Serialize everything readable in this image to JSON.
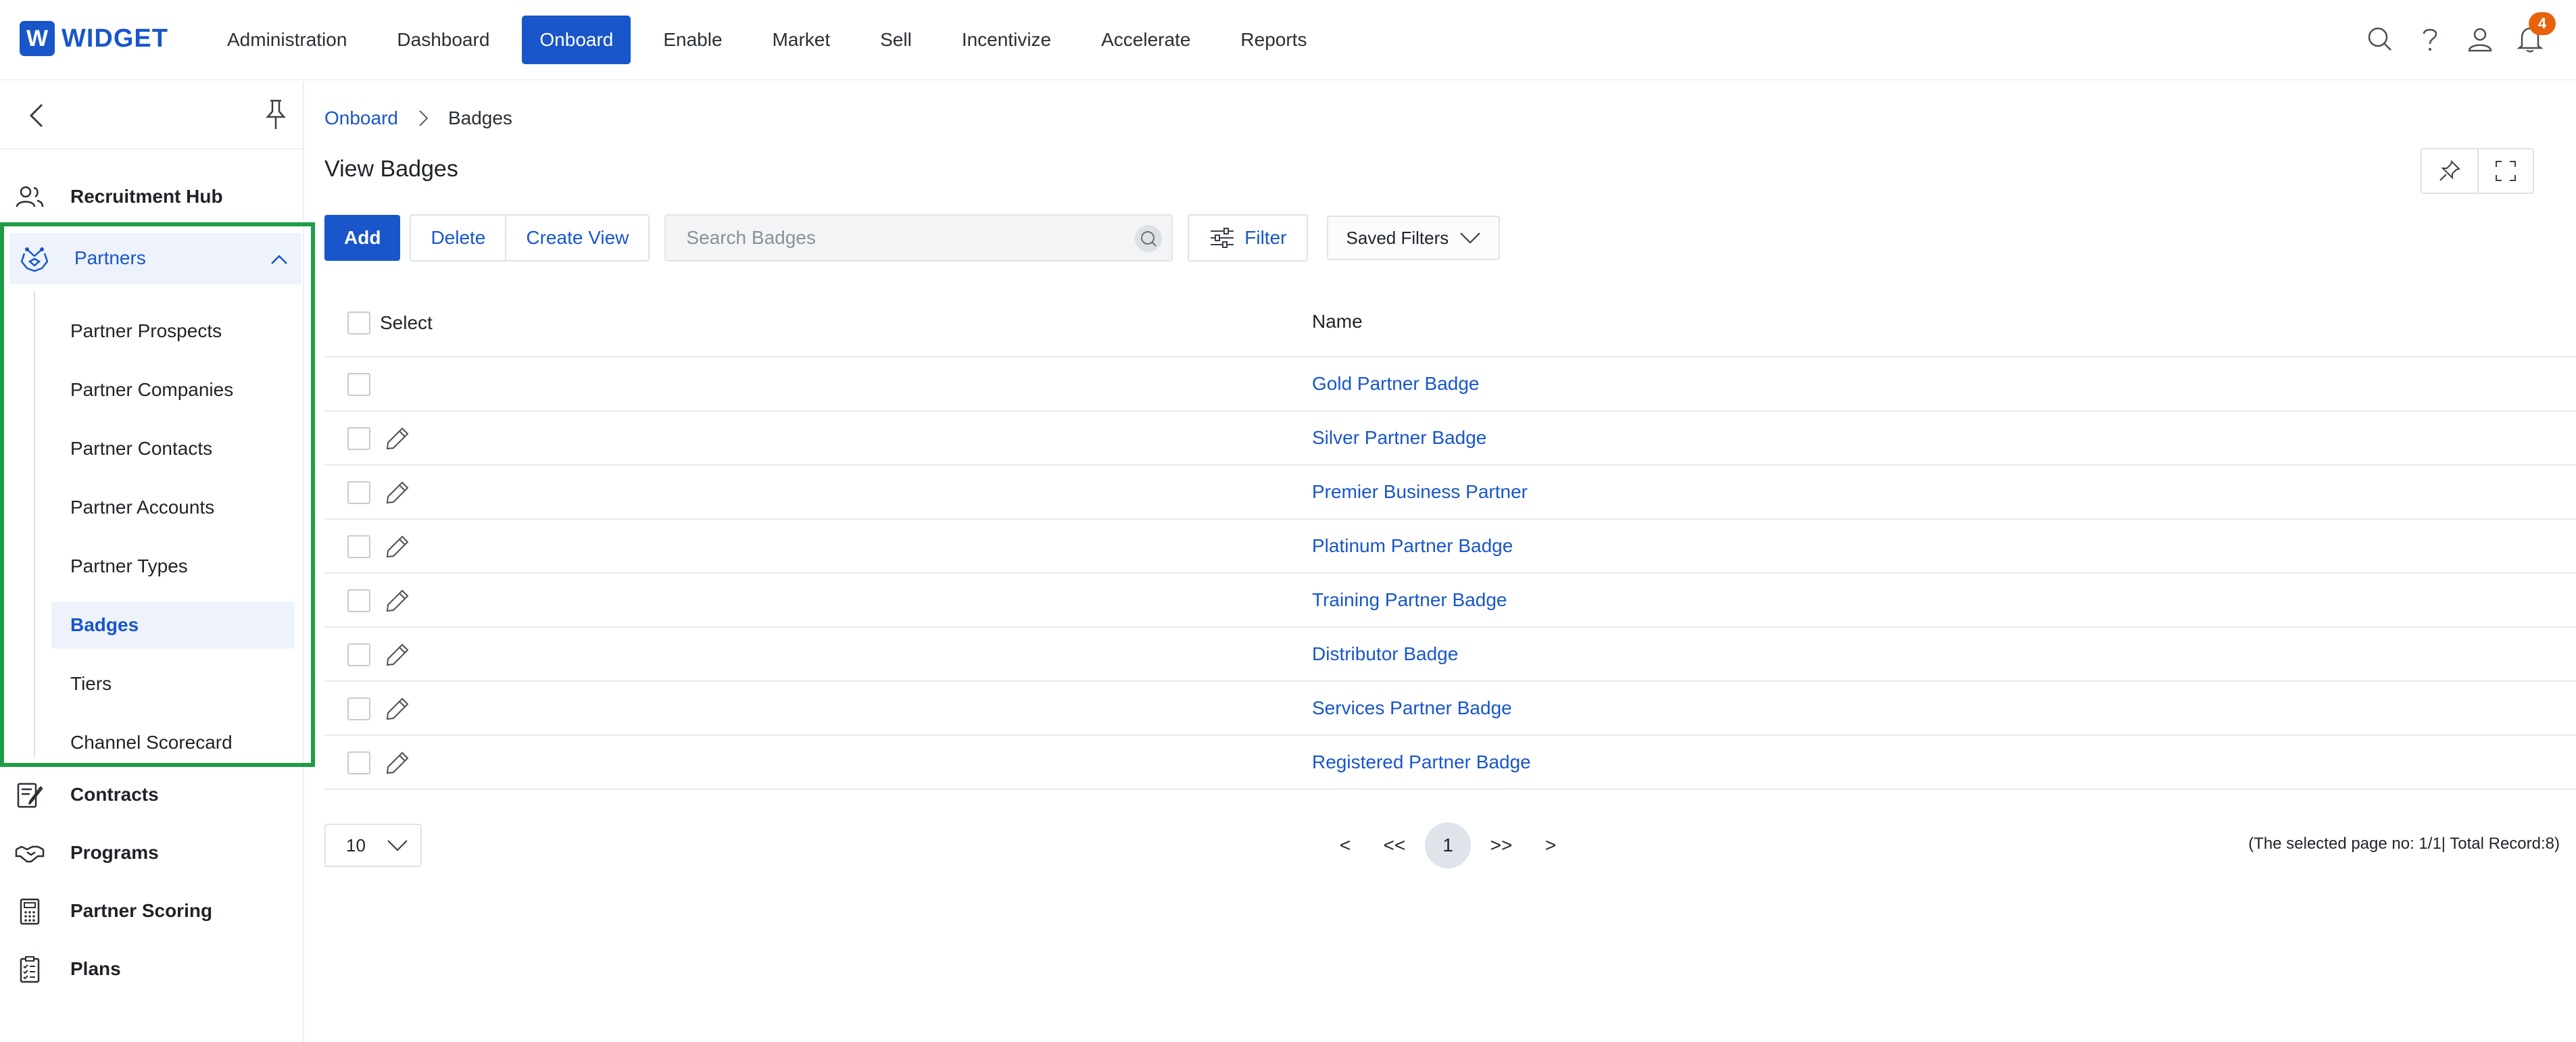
{
  "logo": {
    "letter": "W",
    "text": "WIDGET"
  },
  "nav": [
    {
      "label": "Administration",
      "active": false
    },
    {
      "label": "Dashboard",
      "active": false
    },
    {
      "label": "Onboard",
      "active": true
    },
    {
      "label": "Enable",
      "active": false
    },
    {
      "label": "Market",
      "active": false
    },
    {
      "label": "Sell",
      "active": false
    },
    {
      "label": "Incentivize",
      "active": false
    },
    {
      "label": "Accelerate",
      "active": false
    },
    {
      "label": "Reports",
      "active": false
    }
  ],
  "top_icons": [
    "search-icon",
    "help-icon",
    "user-icon",
    "bell-icon"
  ],
  "notifications": {
    "count": "4"
  },
  "sidebar": {
    "top_items": [
      {
        "label": "Recruitment Hub",
        "icon": "people-icon"
      }
    ],
    "partners": {
      "label": "Partners",
      "icon": "partners-icon",
      "expanded": true,
      "children": [
        {
          "label": "Partner Prospects",
          "active": false
        },
        {
          "label": "Partner Companies",
          "active": false
        },
        {
          "label": "Partner Contacts",
          "active": false
        },
        {
          "label": "Partner Accounts",
          "active": false
        },
        {
          "label": "Partner Types",
          "active": false
        },
        {
          "label": "Badges",
          "active": true
        },
        {
          "label": "Tiers",
          "active": false
        },
        {
          "label": "Channel Scorecard",
          "active": false
        }
      ]
    },
    "bottom_items": [
      {
        "label": "Contracts",
        "icon": "contract-icon"
      },
      {
        "label": "Programs",
        "icon": "handshake-icon"
      },
      {
        "label": "Partner Scoring",
        "icon": "calculator-icon"
      },
      {
        "label": "Plans",
        "icon": "checklist-icon"
      }
    ]
  },
  "breadcrumb": {
    "parent": "Onboard",
    "current": "Badges"
  },
  "page_title": "View Badges",
  "toolbar": {
    "add": "Add",
    "delete": "Delete",
    "create_view": "Create View",
    "search_placeholder": "Search Badges",
    "filter": "Filter",
    "saved_filters": "Saved Filters"
  },
  "table": {
    "col_select": "Select",
    "col_name": "Name",
    "rows": [
      {
        "name": "Gold Partner Badge",
        "editable": false
      },
      {
        "name": "Silver Partner Badge",
        "editable": true
      },
      {
        "name": "Premier Business Partner",
        "editable": true
      },
      {
        "name": "Platinum Partner Badge",
        "editable": true
      },
      {
        "name": "Training Partner Badge",
        "editable": true
      },
      {
        "name": "Distributor Badge",
        "editable": true
      },
      {
        "name": "Services Partner Badge",
        "editable": true
      },
      {
        "name": "Registered Partner Badge",
        "editable": true
      }
    ]
  },
  "pagination": {
    "page_size": "10",
    "prev": "<",
    "first": "<<",
    "current_page": "1",
    "last": ">>",
    "next": ">",
    "info": "(The selected page no: 1/1| Total Record:8)"
  },
  "colors": {
    "brand": "#1856c9",
    "highlight_border": "#1f9d45",
    "notification": "#e8620e"
  }
}
